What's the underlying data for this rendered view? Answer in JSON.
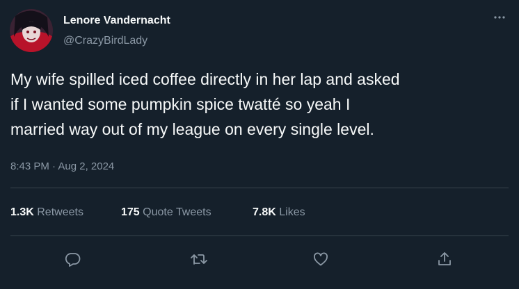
{
  "author": {
    "display_name": "Lenore Vandernacht",
    "handle": "@CrazyBirdLady"
  },
  "tweet": {
    "text_lines": [
      "My wife spilled iced coffee directly in her lap and asked",
      "if I wanted some pumpkin spice twatté so yeah I",
      "married way out of my league on every single level."
    ],
    "timestamp": "8:43 PM · Aug 2, 2024"
  },
  "stats": {
    "retweets": {
      "count": "1.3K",
      "label": "Retweets"
    },
    "quote_tweets": {
      "count": "175",
      "label": "Quote Tweets"
    },
    "likes": {
      "count": "7.8K",
      "label": "Likes"
    }
  },
  "actions": [
    "reply-icon",
    "retweet-icon",
    "like-icon",
    "share-icon"
  ],
  "colors": {
    "background": "#15202b",
    "text_primary": "#f7f9f9",
    "text_secondary": "#8b98a5",
    "divider": "#38444d"
  }
}
